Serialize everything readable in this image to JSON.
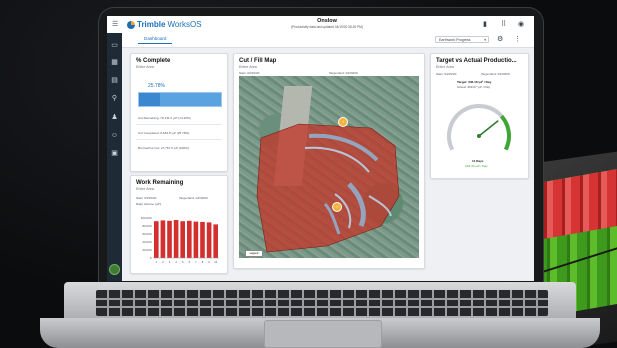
{
  "app": {
    "brand": "Trimble",
    "suite": "WorksOS",
    "project_name": "Onslow",
    "project_sub": "(Productivity data last updated 04/19/20 08:26 PM)"
  },
  "toolbar": {
    "tab": "Dashboard",
    "view_select": "Earthwork Progress"
  },
  "pct_complete": {
    "title": "% Complete",
    "subtitle": "Entire Area",
    "value": "25.78%",
    "fraction": 0.2578,
    "cut_remaining": "Cut Remaining: 79,131 ft yd³ (74.22%)",
    "cut_completed": "Cut Completed: 8,649.8 yd³ (25.78%)",
    "borrow_cut": "Borrow/Cut Cut: 27,767 ft yd³ (100%)"
  },
  "work_remaining": {
    "title": "Work Remaining",
    "subtitle": "Entire Area",
    "start": "Start: 04/15/20",
    "target": "Target End: 04/30/20",
    "ylabel": "Daily Volume (yd³)"
  },
  "cutfill": {
    "title": "Cut / Fill Map",
    "subtitle": "Entire Area",
    "start": "Start: 02/19/20",
    "target": "Target End: 04/30/20",
    "legend": "Legend"
  },
  "target_vs_actual": {
    "title": "Target vs Actual Productio...",
    "subtitle": "Entire Area",
    "start": "Start: 04/15/20",
    "target_end": "Target End: 04/30/20",
    "target": "Target: 346.18 yd³ / Day",
    "actual": "Actual: 309.07 yd³ / Day",
    "days": "11 Days",
    "daily": "333.40 yd³ / Day",
    "gauge_fraction": 0.72
  },
  "chart_data": {
    "type": "bar",
    "categories": [
      "1",
      "2",
      "3",
      "4",
      "5",
      "6",
      "7",
      "8",
      "9",
      "10"
    ],
    "values": [
      92000,
      94000,
      93000,
      95000,
      92000,
      93000,
      91000,
      90000,
      89000,
      84000
    ],
    "yticks": [
      "100,000",
      "80,000",
      "60,000",
      "40,000",
      "20,000",
      "0"
    ],
    "ylim": [
      0,
      100000
    ],
    "color": "#d32f2f"
  },
  "colors": {
    "accent": "#1c6fb7",
    "sidebar": "#1f2a37",
    "fill_red": "#c0392b",
    "gauge_green": "#3fa535"
  }
}
